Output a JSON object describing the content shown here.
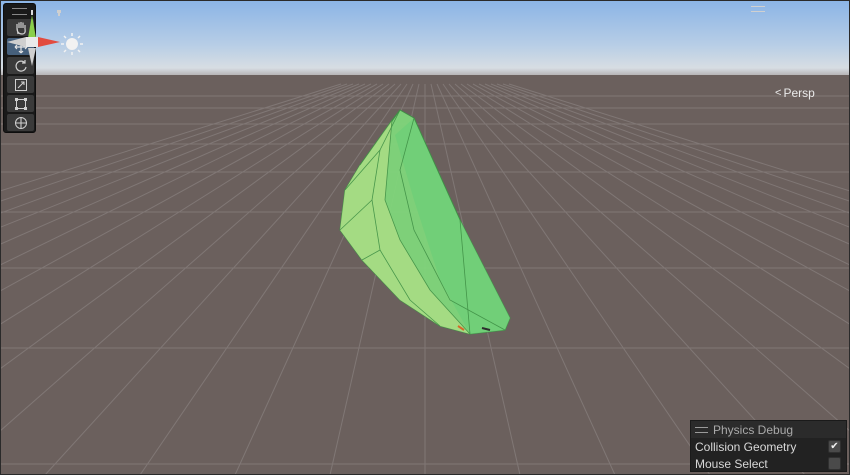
{
  "scene": {
    "projection_label": "Persp",
    "colors": {
      "sky_top": "#8ab4e6",
      "horizon": "#c9d2dc",
      "ground": "#6b605d",
      "grid_line": "#8a8280",
      "mesh_fill": "#7fd67a",
      "mesh_edge": "#3f8f45"
    }
  },
  "toolbar": {
    "tools": [
      {
        "name": "hand-tool",
        "icon": "hand-icon",
        "active": false
      },
      {
        "name": "move-tool",
        "icon": "move-icon",
        "active": true
      },
      {
        "name": "rotate-tool",
        "icon": "rotate-icon",
        "active": false
      },
      {
        "name": "scale-tool",
        "icon": "scale-icon",
        "active": false
      },
      {
        "name": "rect-tool",
        "icon": "rect-transform-icon",
        "active": false
      },
      {
        "name": "transform-tool",
        "icon": "transform-icon",
        "active": false
      }
    ]
  },
  "physics_debug": {
    "title": "Physics Debug",
    "options": [
      {
        "label": "Collision Geometry",
        "checked": true
      },
      {
        "label": "Mouse Select",
        "checked": false
      }
    ]
  }
}
